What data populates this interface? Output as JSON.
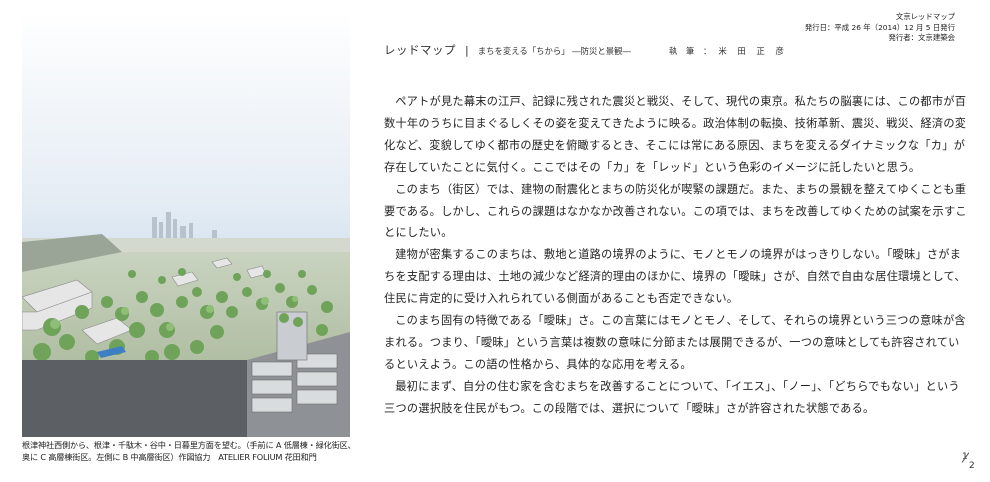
{
  "publication": {
    "name": "文京レッドマップ",
    "date": "発行日：平成 26 年（2014）12 月 5 日発行",
    "publisher": "発行者：文京建築会"
  },
  "header": {
    "title": "レッドマップ",
    "separator": "|",
    "subtitle": "まちを変える「ちから」 ―防災と景観―",
    "author_label": "執 筆 ：",
    "author": "米 田 正 彦"
  },
  "paragraphs": [
    "ペアトが見た幕末の江戸、記録に残された震災と戦災、そして、現代の東京。私たちの脳裏には、この都市が百数十年のうちに目まぐるしくその姿を変えてきたように映る。政治体制の転換、技術革新、震災、戦災、経済の変化など、変貌してゆく都市の歴史を俯瞰するとき、そこには常にある原因、まちを変えるダイナミックな「カ」が存在していたことに気付く。ここではその「カ」を「レッド」という色彩のイメージに託したいと思う。",
    "このまち（街区）では、建物の耐震化とまちの防災化が喫緊の課題だ。また、まちの景観を整えてゆくことも重要である。しかし、これらの課題はなかなか改善されない。この項では、まちを改善してゆくための試案を示すことにしたい。",
    "建物が密集するこのまちは、敷地と道路の境界のように、モノとモノの境界がはっきりしない。「曖昧」さがまちを支配する理由は、土地の減少など経済的理由のほかに、境界の「曖昧」さが、自然で自由な居住環境として、住民に肯定的に受け入れられている側面があることも否定できない。",
    "このまち固有の特徴である「曖昧」さ。この言葉にはモノとモノ、そして、それらの境界という三つの意味が含まれる。つまり、「曖昧」という言葉は複数の意味に分節または展開できるが、一つの意味としても許容されているといえよう。この語の性格から、具体的な応用を考える。",
    "最初にまず、自分の住む家を含むまちを改善することについて、「イエス」、「ノー」、「どちらでもない」という三つの選択肢を住民がもつ。この段階では、選択について「曖昧」さが許容された状態である。"
  ],
  "caption": {
    "line1": "根津神社西側から、根津・千駄木・谷中・日暮里方面を望む。（手前に A 低層棟・緑化街区、",
    "line2": "奥に C 高層棟街区。左側に B 中高層街区）作図協力　ATELIER FOLIUM 花田和門"
  },
  "page_number": {
    "current": "1",
    "total": "2"
  }
}
